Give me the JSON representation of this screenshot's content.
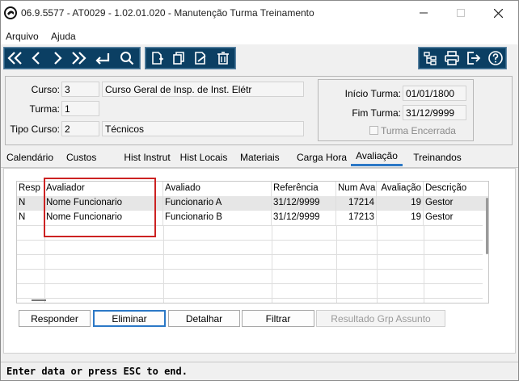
{
  "window": {
    "title": "06.9.5577 - AT0029 - 1.02.01.020 - Manutenção Turma Treinamento"
  },
  "menu": {
    "items": [
      "Arquivo",
      "Ajuda"
    ]
  },
  "toolbar": {
    "nav_icons": [
      "first-icon",
      "previous-icon",
      "next-icon",
      "last-icon",
      "return-icon",
      "search-icon"
    ],
    "edit_icons": [
      "new-record-icon",
      "copy-icon",
      "edit-icon",
      "delete-icon"
    ],
    "right_icons": [
      "tree-icon",
      "print-icon",
      "exit-icon",
      "help-icon"
    ],
    "accent": "#0b3f63"
  },
  "info": {
    "curso_label": "Curso:",
    "curso_code": "3",
    "curso_name": "Curso Geral de Insp. de Inst. Elétr",
    "turma_label": "Turma:",
    "turma_value": "1",
    "tipo_label": "Tipo Curso:",
    "tipo_code": "2",
    "tipo_name": "Técnicos",
    "inicio_label": "Início Turma:",
    "inicio_value": "01/01/1800",
    "fim_label": "Fim Turma:",
    "fim_value": "31/12/9999",
    "encerrada_label": "Turma Encerrada"
  },
  "tabs": [
    "Calendário",
    "Custos",
    "Hist Instrut",
    "Hist Locais",
    "Materiais",
    "Carga Hora",
    "Avaliação",
    "Treinandos"
  ],
  "active_tab": "Avaliação",
  "table": {
    "columns": [
      "Resp",
      "Avaliador",
      "Avaliado",
      "Referência",
      "Num Aval",
      "Avaliação",
      "Descrição"
    ],
    "rows": [
      [
        "N",
        "Nome Funcionario",
        "Funcionario A",
        "31/12/9999",
        "17214",
        "19",
        "Gestor"
      ],
      [
        "N",
        "Nome Funcionario",
        "Funcionario B",
        "31/12/9999",
        "17213",
        "19",
        "Gestor"
      ]
    ]
  },
  "actions": {
    "responder": "Responder",
    "eliminar": "Eliminar",
    "detalhar": "Detalhar",
    "filtrar": "Filtrar",
    "resultado": "Resultado Grp Assunto"
  },
  "status": {
    "text": "Enter data or press ESC to end."
  }
}
